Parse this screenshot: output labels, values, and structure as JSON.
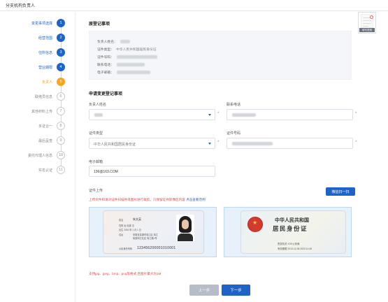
{
  "header": {
    "title": "分支机构负责人"
  },
  "sidebar": {
    "steps": [
      {
        "label": "变更事项选择",
        "num": "1",
        "state": "done"
      },
      {
        "label": "经营范围",
        "num": "2",
        "state": "done"
      },
      {
        "label": "住所信息",
        "num": "3",
        "state": "done"
      },
      {
        "label": "营业期限",
        "num": "4",
        "state": "done"
      },
      {
        "label": "负责人",
        "num": "5",
        "state": "active"
      },
      {
        "label": "联络员信息",
        "num": "6",
        "state": "todo"
      },
      {
        "label": "其他材料上传",
        "num": "7",
        "state": "todo"
      },
      {
        "label": "多证合一",
        "num": "8",
        "state": "todo"
      },
      {
        "label": "最后呈查",
        "num": "9",
        "state": "todo"
      },
      {
        "label": "委托代理人信息",
        "num": "10",
        "state": "todo"
      },
      {
        "label": "实名认证",
        "num": "11",
        "state": "todo"
      }
    ]
  },
  "registered": {
    "title": "原登记事项",
    "rows": [
      {
        "label": "负责人姓名：",
        "value": ""
      },
      {
        "label": "证件类型：",
        "value": "中华人民共和国居民身份证"
      },
      {
        "label": "证件号码：",
        "value": ""
      },
      {
        "label": "联系电话：",
        "value": ""
      },
      {
        "label": "电子邮箱：",
        "value": ""
      }
    ]
  },
  "form": {
    "title": "申请变更登记事项",
    "name_label": "负责人姓名",
    "phone_label": "联系电话",
    "idtype_label": "证件类型",
    "idtype_value": "中华人民共和国居民身份证",
    "idnum_label": "证件号码",
    "email_label": "电子邮箱",
    "email_value": "136@163.COM",
    "required_mark": "*"
  },
  "upload": {
    "title": "证件上传",
    "scan_button": "微信扫一扫",
    "notice": "上传文件和请对证件扫描件或图片进行裁剪，只保留证件影像区内容",
    "notice_link": "点击查看范例",
    "format_note": "支持jpg、jpeg、bmp、png等格式 且图片最大为1M"
  },
  "id_front": {
    "name_label": "姓名",
    "name_value": "朱文英",
    "sex_line": "性别  女   民族  汉",
    "birth_line": "出生  2000 年 1 月 1 日",
    "addr_label": "住址",
    "addr_line1": "安徽省芜湖市鸠江区  鸠江",
    "addr_line2": "街道鸠江社区  鸠江路1号",
    "number_label": "公民身份号码",
    "number": "123456200001010001"
  },
  "id_back": {
    "title1": "中华人民共和国",
    "title2": "居民身份证",
    "authority_line": "签发机关  XXX公安局",
    "validity_line": "有效期限  2013.11.08-2023.11.08"
  },
  "thumbnail": {
    "caption": "填写范例"
  },
  "buttons": {
    "prev": "上一步",
    "next": "下一步"
  }
}
